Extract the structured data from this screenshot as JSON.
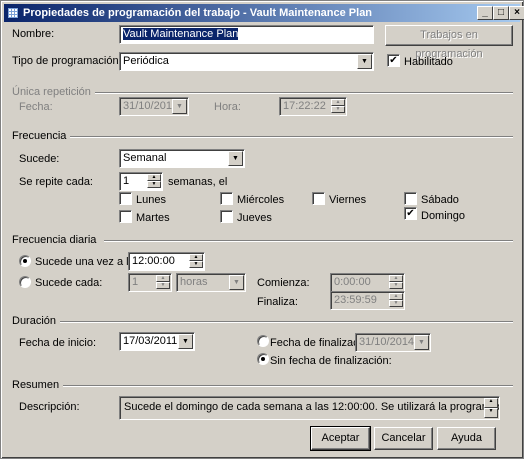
{
  "window": {
    "title": "Propiedades de programación del trabajo - Vault Maintenance Plan",
    "icons": {
      "app": "calendar-grid-icon",
      "minimize": "minimize-icon",
      "maximize": "maximize-icon",
      "close": "close-icon"
    }
  },
  "general": {
    "name_label": "Nombre:",
    "name_value": "Vault Maintenance Plan",
    "jobs_button": "Trabajos en programación",
    "type_label": "Tipo de programación:",
    "type_value": "Periódica",
    "enabled_label": "Habilitado",
    "enabled_checked": true
  },
  "one_time": {
    "title": "Única repetición",
    "date_label": "Fecha:",
    "date_value": "31/10/2014",
    "time_label": "Hora:",
    "time_value": "17:22:22"
  },
  "frequency": {
    "title": "Frecuencia",
    "occurs_label": "Sucede:",
    "occurs_value": "Semanal",
    "repeat_label": "Se repite cada:",
    "repeat_value": "1",
    "repeat_suffix": "semanas, el",
    "days": {
      "lunes": {
        "label": "Lunes",
        "checked": false
      },
      "martes": {
        "label": "Martes",
        "checked": false
      },
      "miercoles": {
        "label": "Miércoles",
        "checked": false
      },
      "jueves": {
        "label": "Jueves",
        "checked": false
      },
      "viernes": {
        "label": "Viernes",
        "checked": false
      },
      "sabado": {
        "label": "Sábado",
        "checked": false
      },
      "domingo": {
        "label": "Domingo",
        "checked": true
      }
    }
  },
  "daily": {
    "title": "Frecuencia diaria",
    "once_label": "Sucede una vez a la(s):",
    "once_value": "12:00:00",
    "every_label": "Sucede cada:",
    "every_value": "1",
    "every_unit": "horas",
    "start_label": "Comienza:",
    "start_value": "0:00:00",
    "end_label": "Finaliza:",
    "end_value": "23:59:59",
    "selected": "once"
  },
  "duration": {
    "title": "Duración",
    "start_label": "Fecha de inicio:",
    "start_value": "17/03/2011",
    "end_label": "Fecha de finalización:",
    "end_value": "31/10/2014",
    "no_end_label": "Sin fecha de finalización:",
    "selected": "no_end"
  },
  "summary": {
    "title": "Resumen",
    "desc_label": "Descripción:",
    "desc_value": "Sucede el domingo de cada semana a las 12:00:00. Se utilizará la programación que empieza el"
  },
  "buttons": {
    "accept": "Aceptar",
    "cancel": "Cancelar",
    "help": "Ayuda"
  }
}
